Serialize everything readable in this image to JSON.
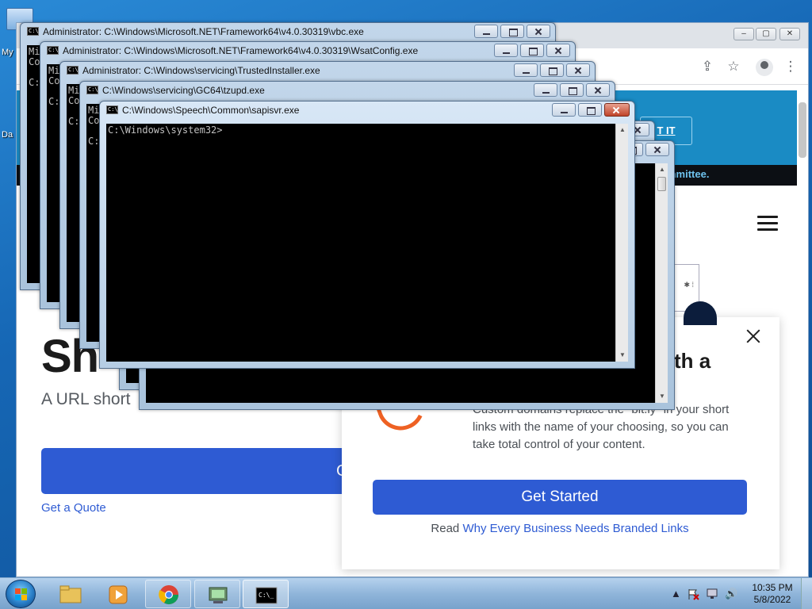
{
  "desktop": {
    "icon_labels": [
      "My",
      "Da"
    ]
  },
  "browser": {
    "page": {
      "banner_button": "T IT",
      "banner_strip_text": "mmittee.",
      "hero_title": "Sh",
      "hero_subtitle": "A URL short",
      "hero_button": "G",
      "hero_link": "Get a Quote"
    },
    "popup": {
      "heading": "th a",
      "body": "Custom domains replace the \"bit.ly\" in your short links with the name of your choosing, so you can take total control of your content.",
      "button": "Get Started",
      "read_prefix": "Read ",
      "read_link": "Why Every Business Needs Branded Links"
    }
  },
  "consoles": [
    {
      "title": "Administrator: C:\\Windows\\Microsoft.NET\\Framework64\\v4.0.30319\\vbc.exe",
      "lines": [
        "Mi",
        "Co",
        "",
        "C:"
      ]
    },
    {
      "title": "Administrator: C:\\Windows\\Microsoft.NET\\Framework64\\v4.0.30319\\WsatConfig.exe",
      "lines": [
        "Mi",
        "Co",
        "",
        "C:"
      ]
    },
    {
      "title": "Administrator: C:\\Windows\\servicing\\TrustedInstaller.exe",
      "lines": [
        "Mi",
        "Co",
        "",
        "C:"
      ]
    },
    {
      "title": "C:\\Windows\\servicing\\GC64\\tzupd.exe",
      "lines": [
        "Mi",
        "Co",
        "",
        "C:"
      ]
    },
    {
      "title": "C:\\Windows\\Speech\\Common\\sapisvr.exe",
      "lines": [
        "C:\\Windows\\system32>"
      ]
    }
  ],
  "taskbar": {
    "time": "10:35 PM",
    "date": "5/8/2022"
  }
}
